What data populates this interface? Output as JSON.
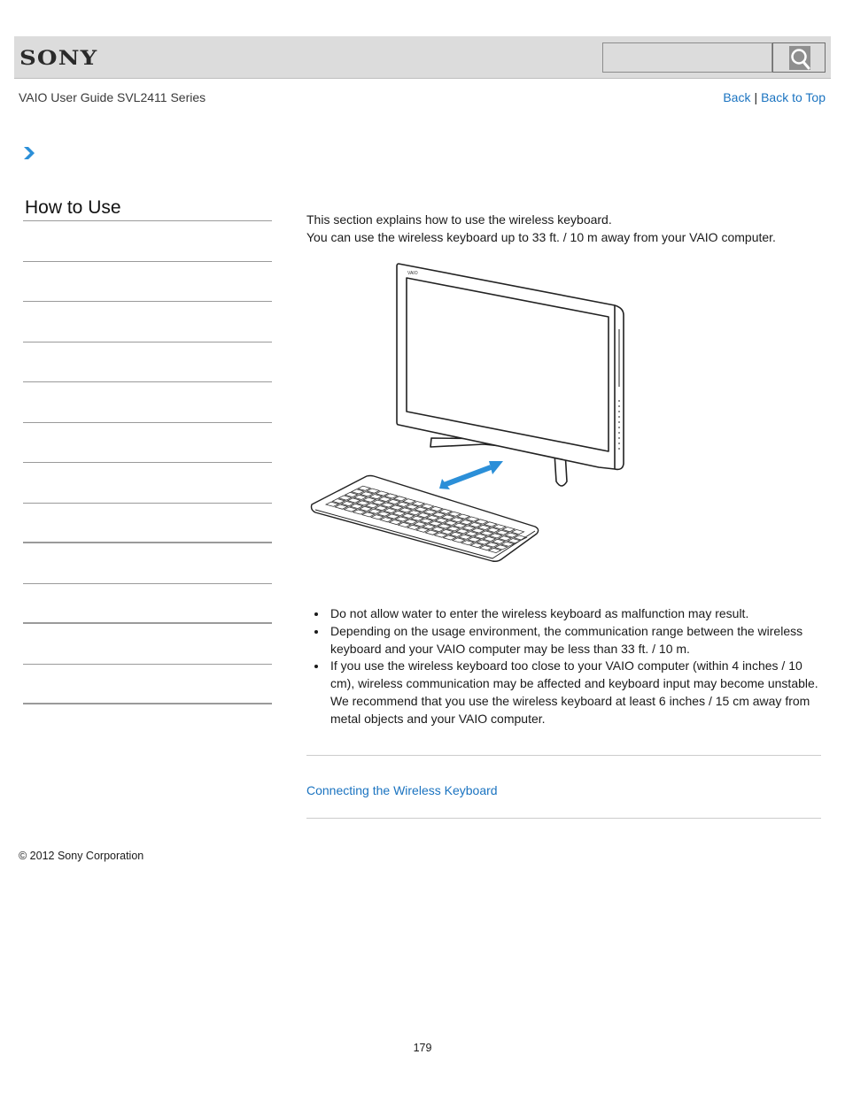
{
  "header": {
    "brand": "SONY",
    "search": {
      "placeholder": "",
      "value": "",
      "icon": "magnifier-icon"
    }
  },
  "subheader": {
    "guide_title": "VAIO User Guide SVL2411 Series",
    "links": [
      {
        "label": "Back"
      },
      {
        "label": "Back to Top"
      }
    ],
    "separator": "|"
  },
  "breadcrumb": {
    "icon": "chevron-right-icon"
  },
  "sidebar": {
    "title": "How to Use",
    "items": [
      {
        "label": ""
      },
      {
        "label": ""
      },
      {
        "label": ""
      },
      {
        "label": ""
      },
      {
        "label": ""
      },
      {
        "label": ""
      },
      {
        "label": ""
      },
      {
        "label": ""
      },
      {
        "label": ""
      },
      {
        "label": ""
      },
      {
        "label": ""
      },
      {
        "label": ""
      }
    ]
  },
  "main": {
    "intro": [
      "This section explains how to use the wireless keyboard.",
      "You can use the wireless keyboard up to 33 ft. / 10 m away from your VAIO computer."
    ],
    "illustration": {
      "description": "All-in-one VAIO computer and wireless keyboard with a bidirectional arrow",
      "monitor_logo": "VAIO",
      "arrow_color": "#2b8fd8"
    },
    "notes": [
      "Do not allow water to enter the wireless keyboard as malfunction may result.",
      "Depending on the usage environment, the communication range between the wireless keyboard and your VAIO computer may be less than 33 ft. / 10 m.",
      "If you use the wireless keyboard too close to your VAIO computer (within 4 inches / 10 cm), wireless communication may be affected and keyboard input may become unstable. We recommend that you use the wireless keyboard at least 6 inches / 15 cm away from metal objects and your VAIO computer."
    ],
    "related_topics": [
      {
        "label": "Connecting the Wireless Keyboard"
      }
    ]
  },
  "footer": {
    "copyright": "© 2012 Sony Corporation",
    "page_number": "179"
  },
  "colors": {
    "link": "#1a73c0",
    "header_bg": "#dcdcdc",
    "accent_chevron": "#2b8fd8"
  }
}
